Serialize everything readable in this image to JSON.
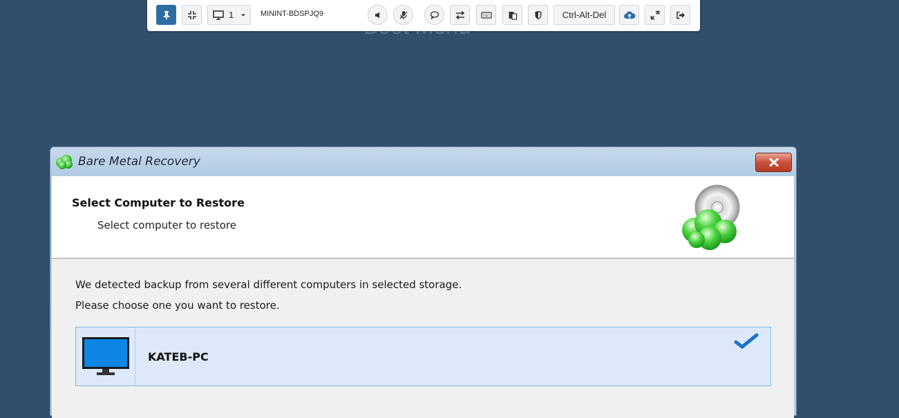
{
  "background": {
    "title": "Boot Menu"
  },
  "toolbar": {
    "monitor_number": "1",
    "host_name": "MININT-BDSPJQ9",
    "ctrl_alt_del_label": "Ctrl-Alt-Del",
    "icons": [
      "pin-icon",
      "collapse-icon",
      "monitor-icon",
      "chevron-down-icon",
      "speaker-icon",
      "mic-muted-icon",
      "chat-icon",
      "transfer-icon",
      "keyboard-icon",
      "clipboard-icon",
      "shield-icon",
      "cloud-upload-icon",
      "fullscreen-icon",
      "exit-icon"
    ]
  },
  "dialog": {
    "title": "Bare Metal Recovery",
    "header_title": "Select Computer to Restore",
    "header_subtitle": "Select computer to restore",
    "message_line1": "We detected backup from several different computers in selected storage.",
    "message_line2": "Please choose one you want to restore.",
    "computers": [
      {
        "name": "KATEB-PC",
        "selected": true
      }
    ]
  },
  "colors": {
    "desktop_bg": "#314e6c",
    "accent": "#2e6da4",
    "selection_bg": "#dde9f8",
    "checkmark": "#1c74c9"
  }
}
